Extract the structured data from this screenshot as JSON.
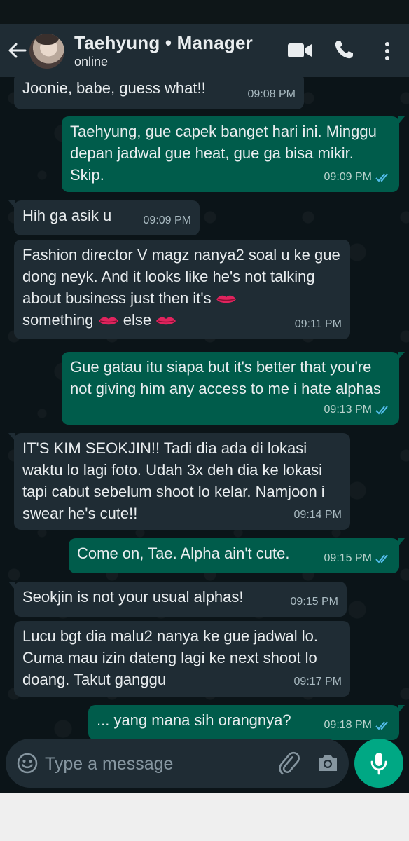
{
  "header": {
    "contact_name": "Taehyung • Manager",
    "contact_status": "online",
    "colors": {
      "app_bar": "#1f2c34",
      "incoming": "#1f2c34",
      "outgoing": "#005c4b",
      "accent": "#00a884",
      "read_ticks": "#53bdeb"
    }
  },
  "messages": [
    {
      "direction": "in",
      "text": "Joonie, babe, guess what!!",
      "time": "09:08 PM"
    },
    {
      "direction": "out",
      "text": "Taehyung, gue capek banget hari ini. Minggu depan jadwal gue heat, gue ga bisa mikir. Skip.",
      "time": "09:09 PM",
      "status": "read"
    },
    {
      "direction": "in",
      "text": "Hih ga asik u",
      "time": "09:09 PM"
    },
    {
      "direction": "in",
      "text_part1": "Fashion director V magz nanya2 soal u ke gue dong neyk. And it looks like he's not talking about business just then it's",
      "text_part2": "something",
      "text_part3": "else",
      "emoji": "lips",
      "time": "09:11 PM"
    },
    {
      "direction": "out",
      "text": "Gue gatau itu siapa but it's better that you're not giving him any access to me i hate alphas",
      "time": "09:13 PM",
      "status": "read"
    },
    {
      "direction": "in",
      "text": "IT'S KIM SEOKJIN!! Tadi dia ada di lokasi waktu lo lagi foto. Udah 3x deh dia ke lokasi tapi cabut sebelum shoot lo kelar. Namjoon i swear he's cute!!",
      "time": "09:14 PM"
    },
    {
      "direction": "out",
      "text": "Come on, Tae. Alpha ain't cute.",
      "time": "09:15 PM",
      "status": "read"
    },
    {
      "direction": "in",
      "text": "Seokjin is not your usual alphas!",
      "time": "09:15 PM"
    },
    {
      "direction": "in",
      "text": "Lucu bgt dia malu2 nanya ke gue jadwal lo. Cuma mau izin dateng lagi ke next shoot lo doang. Takut ganggu",
      "time": "09:17 PM"
    },
    {
      "direction": "out",
      "text": "... yang mana sih orangnya?",
      "time": "09:18 PM",
      "status": "read"
    }
  ],
  "composer": {
    "placeholder": "Type a message"
  }
}
